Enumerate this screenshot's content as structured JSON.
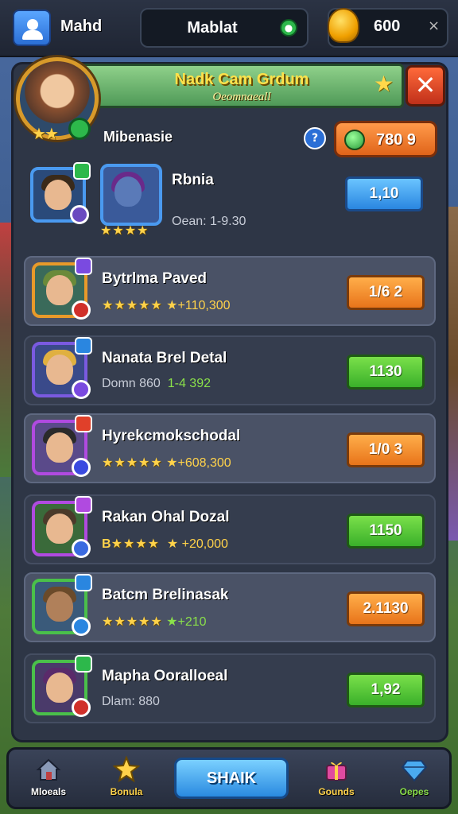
{
  "topbar": {
    "player_name": "Mahd",
    "center_label": "Mablat",
    "currency_value": "600",
    "currency_close": "×"
  },
  "panel": {
    "title": "Nadk Cam Grdum",
    "subtitle": "Oeomnaeall",
    "close_label": "✕",
    "hero_stars": "★★",
    "section_label": "Mibenasie",
    "info_label": "?",
    "gem_value": "780 9"
  },
  "rows": [
    {
      "name": "Rbnia",
      "sub_prefix": "",
      "sub_stars": "★★★★",
      "sub_text": "Oean: 1-9.30",
      "button": "1,10",
      "button_style": "blue"
    },
    {
      "name": "Bytrlma Paved",
      "sub_stars": "★★★★★",
      "sub_text": "★+110,300",
      "button": "1/6 2",
      "button_style": "orange"
    },
    {
      "name": "Nanata Brel Detal",
      "sub_label": "Domn 860",
      "sub_text": "1-4 392",
      "button": "1130",
      "button_style": "green"
    },
    {
      "name": "Hyrekcmokschodal",
      "sub_stars": "★★★★★",
      "sub_text": "★+608,300",
      "button": "1/0 3",
      "button_style": "orange"
    },
    {
      "name": "Rakan Ohal Dozal",
      "sub_prefix": "B",
      "sub_stars": "★★★★",
      "sub_text": "★ +20,000",
      "button": "1150",
      "button_style": "green"
    },
    {
      "name": "Batcm Brelinasak",
      "sub_stars": "★★★★★",
      "sub_text": "★+210",
      "button": "2.1130",
      "button_style": "orange"
    },
    {
      "name": "Mapha Ooralloeal",
      "sub_label": "Dlam: 880",
      "button": "1,92",
      "button_style": "green"
    }
  ],
  "bottom_nav": {
    "items": [
      {
        "label": "Mloeals",
        "icon": "home-icon"
      },
      {
        "label": "Bonula",
        "icon": "star-icon"
      },
      {
        "label": "Gounds",
        "icon": "gift-icon"
      },
      {
        "label": "Oepes",
        "icon": "gem-icon"
      }
    ],
    "share_label": "SHAIK"
  },
  "colors": {
    "panel_bg": "#2e3646",
    "accent_gold": "#ffd24a",
    "button_blue": "#2a86e0",
    "button_orange": "#e8741a",
    "button_green": "#3ab02a"
  }
}
